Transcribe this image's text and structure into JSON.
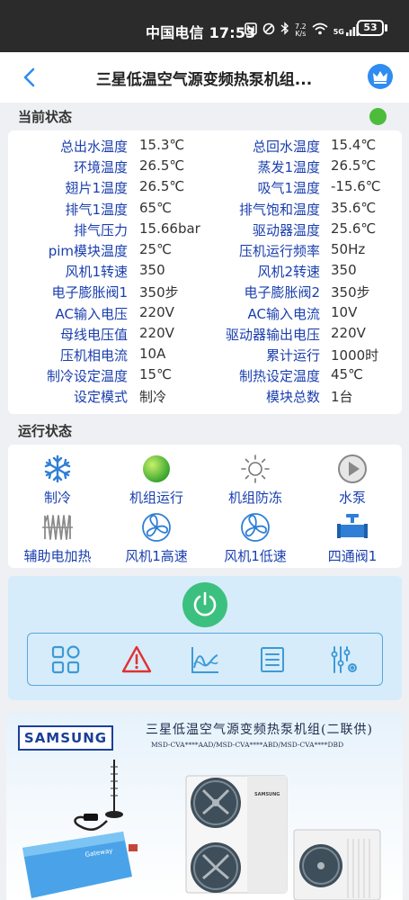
{
  "statusbar": {
    "carrier_time": "中国电信 17:53",
    "icons": [
      "nfc-icon",
      "vibrate-icon",
      "bluetooth-icon",
      "wifi-icon",
      "signal-icon"
    ],
    "speed_value": "7.2",
    "speed_unit": "K/s",
    "network": "5G",
    "battery": "53"
  },
  "header": {
    "title": "三星低温空气源变频热泵机组..."
  },
  "current_status": {
    "title": "当前状态",
    "indicator_color": "#4cbc3a",
    "rows": [
      {
        "l1": "总出水温度",
        "v1": "15.3℃",
        "l2": "总回水温度",
        "v2": "15.4℃"
      },
      {
        "l1": "环境温度",
        "v1": "26.5℃",
        "l2": "蒸发1温度",
        "v2": "26.5℃"
      },
      {
        "l1": "翅片1温度",
        "v1": "26.5℃",
        "l2": "吸气1温度",
        "v2": "-15.6℃"
      },
      {
        "l1": "排气1温度",
        "v1": "65℃",
        "l2": "排气饱和温度",
        "v2": "35.6℃"
      },
      {
        "l1": "排气压力",
        "v1": "15.66bar",
        "l2": "驱动器温度",
        "v2": "25.6℃"
      },
      {
        "l1": "pim模块温度",
        "v1": "25℃",
        "l2": "压机运行频率",
        "v2": "50Hz"
      },
      {
        "l1": "风机1转速",
        "v1": "350",
        "l2": "风机2转速",
        "v2": "350"
      },
      {
        "l1": "电子膨胀阀1",
        "v1": "350步",
        "l2": "电子膨胀阀2",
        "v2": "350步"
      },
      {
        "l1": "AC输入电压",
        "v1": "220V",
        "l2": "AC输入电流",
        "v2": "10V"
      },
      {
        "l1": "母线电压值",
        "v1": "220V",
        "l2": "驱动器输出电压",
        "v2": "220V"
      },
      {
        "l1": "压机相电流",
        "v1": "10A",
        "l2": "累计运行",
        "v2": "1000时"
      },
      {
        "l1": "制冷设定温度",
        "v1": "15℃",
        "l2": "制热设定温度",
        "v2": "45℃"
      },
      {
        "l1": "设定模式",
        "v1": "制冷",
        "l2": "模块总数",
        "v2": "1台"
      }
    ]
  },
  "run_status": {
    "title": "运行状态",
    "items": [
      {
        "label": "制冷",
        "icon": "snowflake-icon"
      },
      {
        "label": "机组运行",
        "icon": "green-ball-icon"
      },
      {
        "label": "机组防冻",
        "icon": "sun-icon"
      },
      {
        "label": "水泵",
        "icon": "play-icon"
      },
      {
        "label": "辅助电加热",
        "icon": "heater-icon"
      },
      {
        "label": "风机1高速",
        "icon": "fan-icon"
      },
      {
        "label": "风机1低速",
        "icon": "fan-icon"
      },
      {
        "label": "四通阀1",
        "icon": "valve-icon"
      }
    ]
  },
  "controls": {
    "power_icon": "power-icon",
    "tools": [
      "grid-icon",
      "warning-icon",
      "chart-icon",
      "list-icon",
      "settings-sliders-icon"
    ]
  },
  "banner": {
    "brand": "SAMSUNG",
    "title": "三星低温空气源变频热泵机组(二联供)",
    "models": "MSD-CVA****AAD/MSD-CVA****ABD/MSD-CVA****DBD",
    "unit_brand": "SAMSUNG"
  },
  "colors": {
    "label_blue": "#1a3fae",
    "accent_blue": "#2f8cf0",
    "power_green": "#3cc07f",
    "panel_bg": "#d6ecfa"
  }
}
